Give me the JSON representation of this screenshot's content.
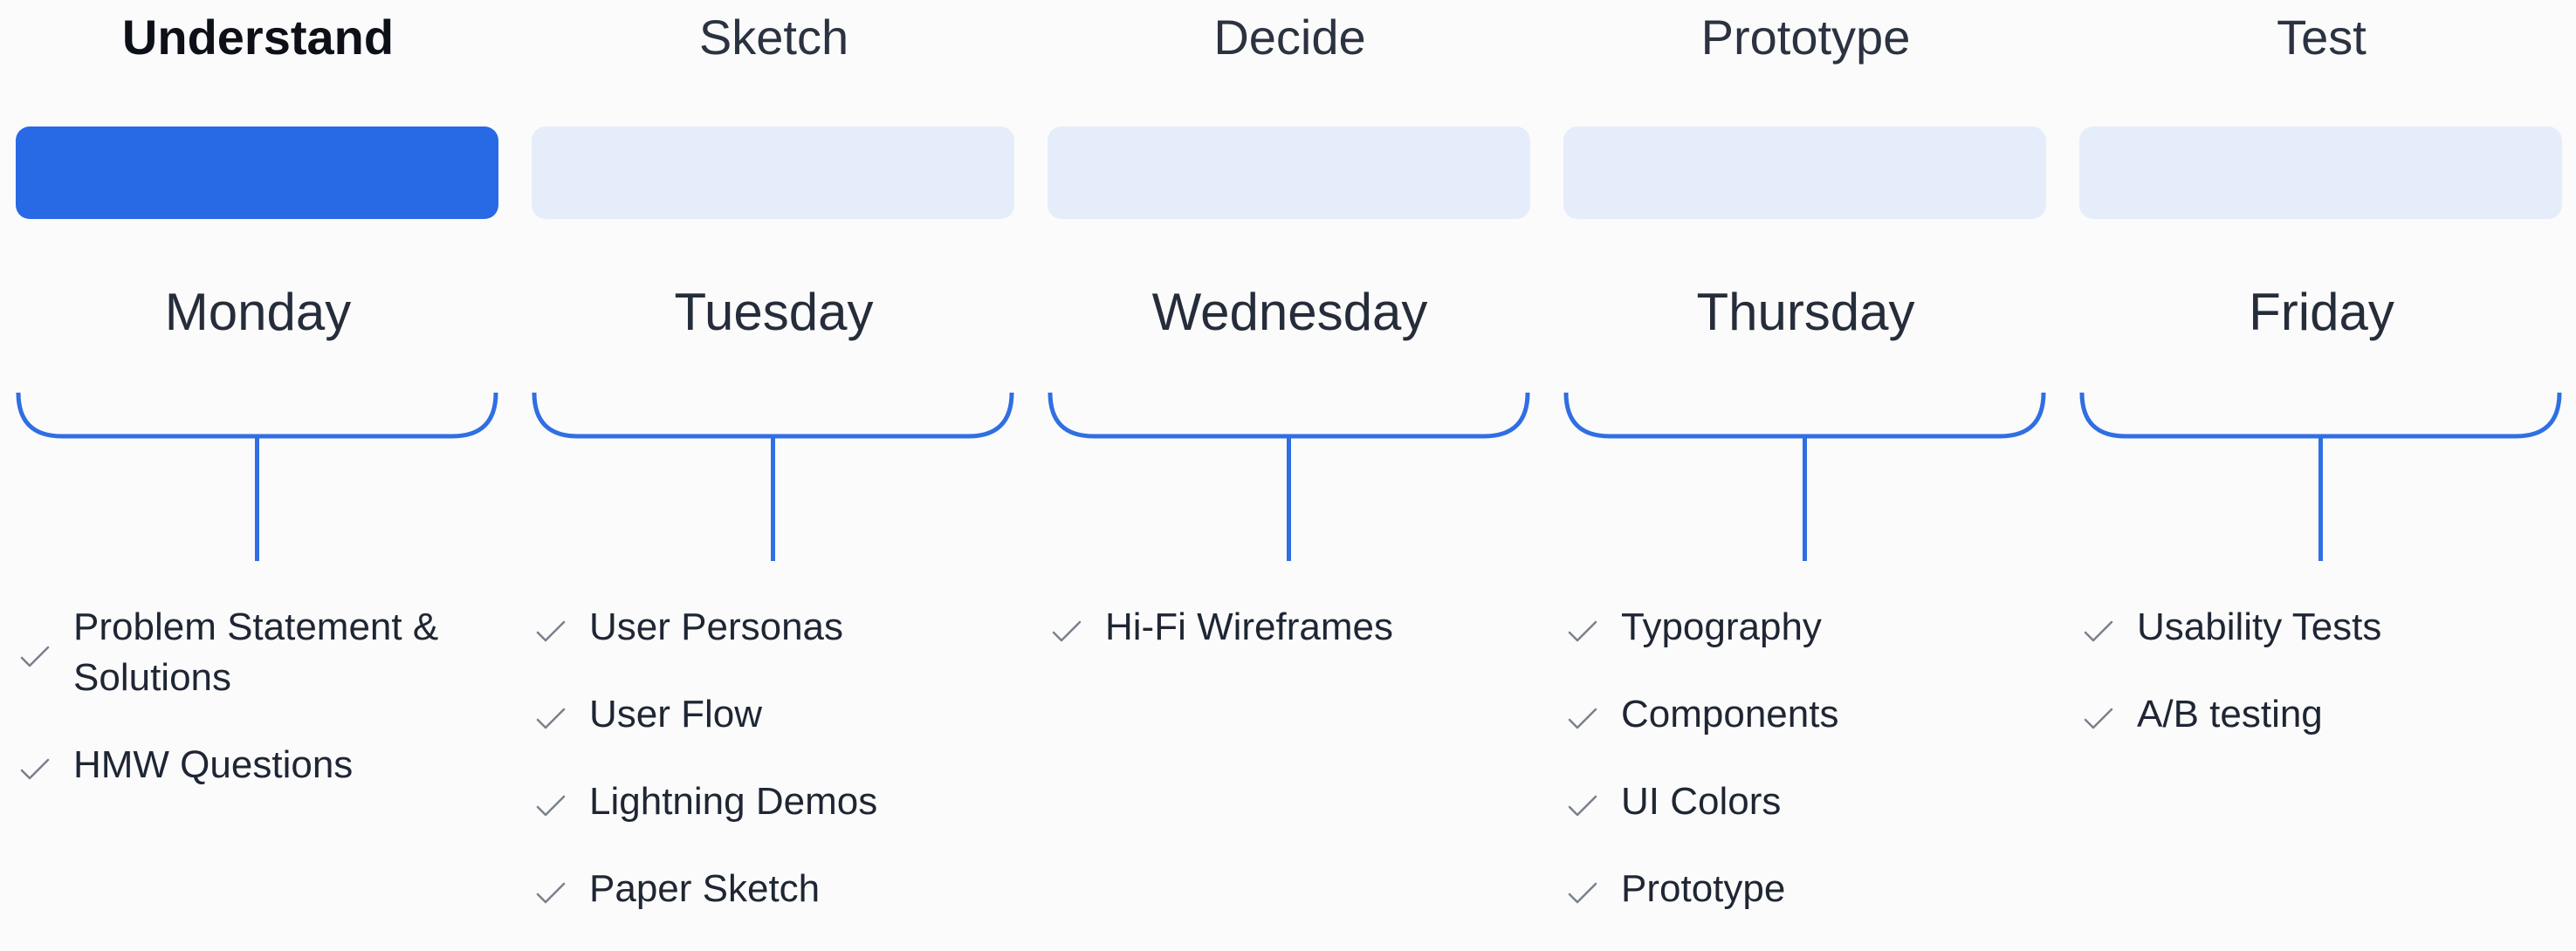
{
  "colors": {
    "accent": "#2869e5",
    "inactive_bar": "#e5edfa",
    "text": "#1f2633"
  },
  "phases": [
    {
      "tab": "Understand",
      "day": "Monday",
      "active": true,
      "tasks": [
        "Problem Statement & Solutions",
        "HMW Questions"
      ]
    },
    {
      "tab": "Sketch",
      "day": "Tuesday",
      "active": false,
      "tasks": [
        "User Personas",
        "User Flow",
        "Lightning Demos",
        "Paper Sketch"
      ]
    },
    {
      "tab": "Decide",
      "day": "Wednesday",
      "active": false,
      "tasks": [
        "Hi-Fi Wireframes"
      ]
    },
    {
      "tab": "Prototype",
      "day": "Thursday",
      "active": false,
      "tasks": [
        "Typography",
        "Components",
        "UI Colors",
        "Prototype"
      ]
    },
    {
      "tab": "Test",
      "day": "Friday",
      "active": false,
      "tasks": [
        "Usability Tests",
        "A/B testing"
      ]
    }
  ]
}
